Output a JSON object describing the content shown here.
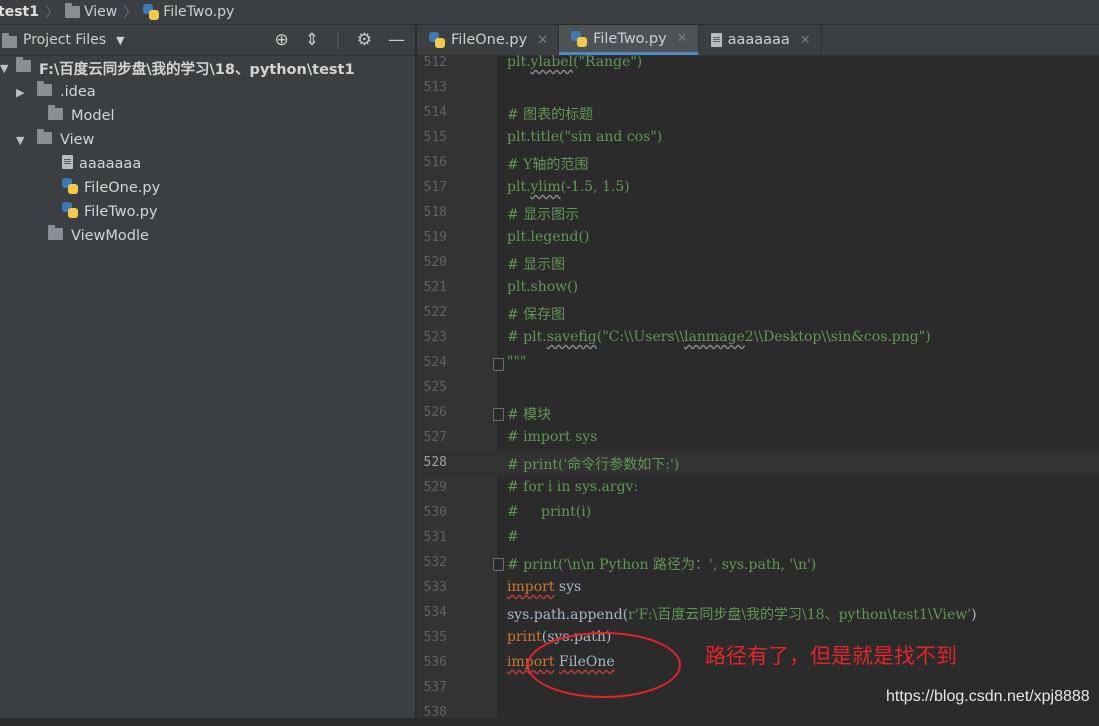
{
  "breadcrumb": {
    "project": "test1",
    "folder": "View",
    "file": "FileTwo.py"
  },
  "panel": {
    "title": "Project Files",
    "tree": [
      {
        "label": "F:\\百度云同步盘\\我的学习\\18、python\\test1",
        "kind": "folder",
        "depth": 0,
        "arrow": "▼",
        "bold": true
      },
      {
        "label": ".idea",
        "kind": "folder",
        "depth": 1,
        "arrow": "▶"
      },
      {
        "label": "Model",
        "kind": "folder",
        "depth": 1,
        "arrow": ""
      },
      {
        "label": "View",
        "kind": "folder",
        "depth": 1,
        "arrow": "▼"
      },
      {
        "label": "aaaaaaa",
        "kind": "text",
        "depth": 2,
        "arrow": ""
      },
      {
        "label": "FileOne.py",
        "kind": "python",
        "depth": 2,
        "arrow": ""
      },
      {
        "label": "FileTwo.py",
        "kind": "python",
        "depth": 2,
        "arrow": ""
      },
      {
        "label": "ViewModle",
        "kind": "folder",
        "depth": 1,
        "arrow": ""
      }
    ]
  },
  "tabs": [
    {
      "label": "FileOne.py",
      "kind": "python",
      "active": false
    },
    {
      "label": "FileTwo.py",
      "kind": "python",
      "active": true
    },
    {
      "label": "aaaaaaa",
      "kind": "text",
      "active": false
    }
  ],
  "editor": {
    "current_line": 528,
    "lines": [
      {
        "n": 512,
        "html": "<span class='cm'>plt.<span class='sq2'>ylabel</span>(\"Range\")</span>"
      },
      {
        "n": 513,
        "html": ""
      },
      {
        "n": 514,
        "html": "<span class='cm'># 图表的标题</span>"
      },
      {
        "n": 515,
        "html": "<span class='cm'>plt.title(\"sin and cos\")</span>"
      },
      {
        "n": 516,
        "html": "<span class='cm'># Y轴的范围</span>"
      },
      {
        "n": 517,
        "html": "<span class='cm'>plt.<span class='sq2'>ylim</span>(-1.5, 1.5)</span>"
      },
      {
        "n": 518,
        "html": "<span class='cm'># 显示图示</span>"
      },
      {
        "n": 519,
        "html": "<span class='cm'>plt.legend()</span>"
      },
      {
        "n": 520,
        "html": "<span class='cm'># 显示图</span>"
      },
      {
        "n": 521,
        "html": "<span class='cm'>plt.show()</span>"
      },
      {
        "n": 522,
        "html": "<span class='cm'># 保存图</span>"
      },
      {
        "n": 523,
        "html": "<span class='cm'># plt.<span class='sq2'>savefig</span>(\"C:\\\\Users\\\\<span class='sq2'>lanmage</span>2\\\\Desktop\\\\sin&amp;cos.png\")</span>"
      },
      {
        "n": 524,
        "html": "<span class='cm'>\"\"\"</span>",
        "fold": true
      },
      {
        "n": 525,
        "html": ""
      },
      {
        "n": 526,
        "html": "<span class='cm'># 模块</span>",
        "fold": true
      },
      {
        "n": 527,
        "html": "<span class='cm'># import sys</span>"
      },
      {
        "n": 528,
        "html": "<span class='cm'># print('命令行参数如下:')</span>"
      },
      {
        "n": 529,
        "html": "<span class='cm'># for i in sys.argv:</span>"
      },
      {
        "n": 530,
        "html": "<span class='cm'>#     print(i)</span>"
      },
      {
        "n": 531,
        "html": "<span class='cm'>#</span>"
      },
      {
        "n": 532,
        "html": "<span class='cm'># print('\\n\\n Python 路径为：', sys.path, '\\n')</span>",
        "fold": true
      },
      {
        "n": 533,
        "html": "<span class='hl sq'>import</span> sys"
      },
      {
        "n": 534,
        "html": "sys.path.append(<span class='cm'>r'F:\\百度云同步盘\\我的学习\\18、python\\test1\\View'</span>)"
      },
      {
        "n": 535,
        "html": "<span class='hl'>print</span>(sys.path)"
      },
      {
        "n": 536,
        "html": "<span class='hl sq'>import</span> <span class='sq'>FileOne</span>"
      },
      {
        "n": 537,
        "html": ""
      },
      {
        "n": 538,
        "html": ""
      }
    ]
  },
  "annotation": "路径有了，但是就是找不到",
  "watermark": "https://blog.csdn.net/xpj8888"
}
